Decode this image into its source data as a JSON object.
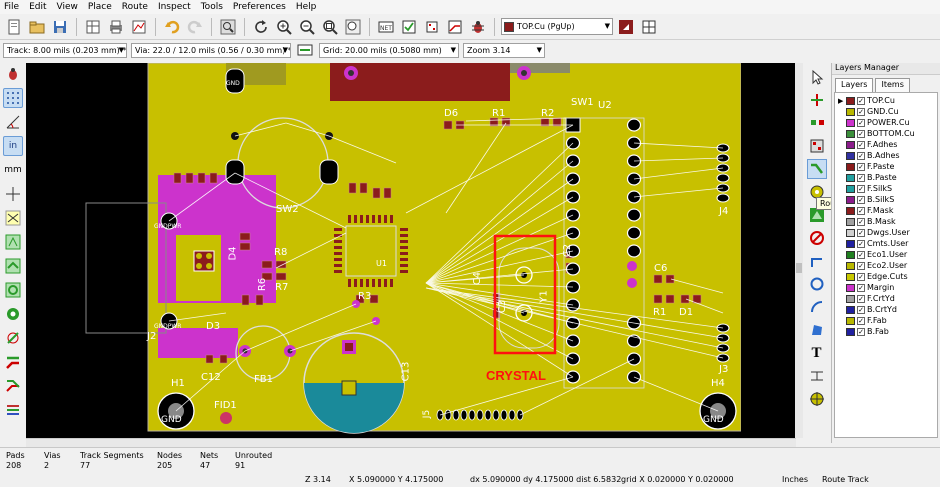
{
  "menu": [
    "File",
    "Edit",
    "View",
    "Place",
    "Route",
    "Inspect",
    "Tools",
    "Preferences",
    "Help"
  ],
  "layer_select": {
    "value": "TOP.Cu (PgUp)",
    "color": "#8b1c1c"
  },
  "options": {
    "track": "Track: 8.00 mils (0.203 mm) *",
    "via": "Via: 22.0 / 12.0 mils (0.56 / 0.30 mm) *",
    "grid": "Grid: 20.00 mils (0.5080 mm)",
    "zoom": "Zoom 3.14"
  },
  "tooltip": "Route tracks",
  "layers_manager": {
    "title": "Layers Manager",
    "tabs": [
      "Layers",
      "Items"
    ],
    "layers": [
      {
        "name": "TOP.Cu",
        "color": "#8b1c1c",
        "active": true
      },
      {
        "name": "GND.Cu",
        "color": "#b8b800"
      },
      {
        "name": "POWER.Cu",
        "color": "#cc33cc"
      },
      {
        "name": "BOTTOM.Cu",
        "color": "#3b8f3b"
      },
      {
        "name": "F.Adhes",
        "color": "#8b1c8b"
      },
      {
        "name": "B.Adhes",
        "color": "#3030a0"
      },
      {
        "name": "F.Paste",
        "color": "#8b1c1c"
      },
      {
        "name": "B.Paste",
        "color": "#20a0a0"
      },
      {
        "name": "F.SilkS",
        "color": "#20a0a0"
      },
      {
        "name": "B.SilkS",
        "color": "#8b1c8b"
      },
      {
        "name": "F.Mask",
        "color": "#8b1c1c"
      },
      {
        "name": "B.Mask",
        "color": "#a0a0a0"
      },
      {
        "name": "Dwgs.User",
        "color": "#d0d0d0"
      },
      {
        "name": "Cmts.User",
        "color": "#2020a0"
      },
      {
        "name": "Eco1.User",
        "color": "#208020"
      },
      {
        "name": "Eco2.User",
        "color": "#b8b800"
      },
      {
        "name": "Edge.Cuts",
        "color": "#c8c800"
      },
      {
        "name": "Margin",
        "color": "#cc33cc"
      },
      {
        "name": "F.CrtYd",
        "color": "#a0a0a0"
      },
      {
        "name": "B.CrtYd",
        "color": "#2020a0"
      },
      {
        "name": "F.Fab",
        "color": "#b8b800"
      },
      {
        "name": "B.Fab",
        "color": "#2020a0"
      }
    ]
  },
  "status": {
    "cols": [
      {
        "label": "Pads",
        "value": "208"
      },
      {
        "label": "Vias",
        "value": "2"
      },
      {
        "label": "Track Segments",
        "value": "77"
      },
      {
        "label": "Nodes",
        "value": "205"
      },
      {
        "label": "Nets",
        "value": "47"
      },
      {
        "label": "Unrouted",
        "value": "91"
      }
    ],
    "zoom": "Z 3.14",
    "xy": "X 5.090000  Y 4.175000",
    "delta": "dx 5.090000  dy 4.175000  dist 6.5832",
    "grid": "grid X 0.020000  Y 0.020000",
    "units": "Inches",
    "mode": "Route Track"
  },
  "board": {
    "labels": {
      "gnd_top": "GND",
      "sw2": "SW2",
      "d6": "D6",
      "r1": "R1",
      "r2": "R2",
      "sw1": "SW1",
      "u2": "U2",
      "j4": "J4",
      "c4": "C4",
      "c3": "C3",
      "c2": "C2",
      "y1": "Y1",
      "c6": "C6",
      "r1b": "R1",
      "d1": "D1",
      "r8": "R8",
      "r7": "R7",
      "r3": "R3",
      "d3": "D3",
      "c12": "C12",
      "fb1": "FB1",
      "c13": "C13",
      "j3": "J3",
      "h1": "H1",
      "h4": "H4",
      "fid1": "FID1",
      "j5": "J5",
      "gndpwr1": "GNDPWR",
      "gndpwr2": "GNDPWR",
      "gnd_h1": "GND",
      "gnd_h4": "GND",
      "j2": "J2",
      "d4": "D4",
      "r6": "R6",
      "u1": "U1"
    },
    "annotation": "CRYSTAL"
  }
}
